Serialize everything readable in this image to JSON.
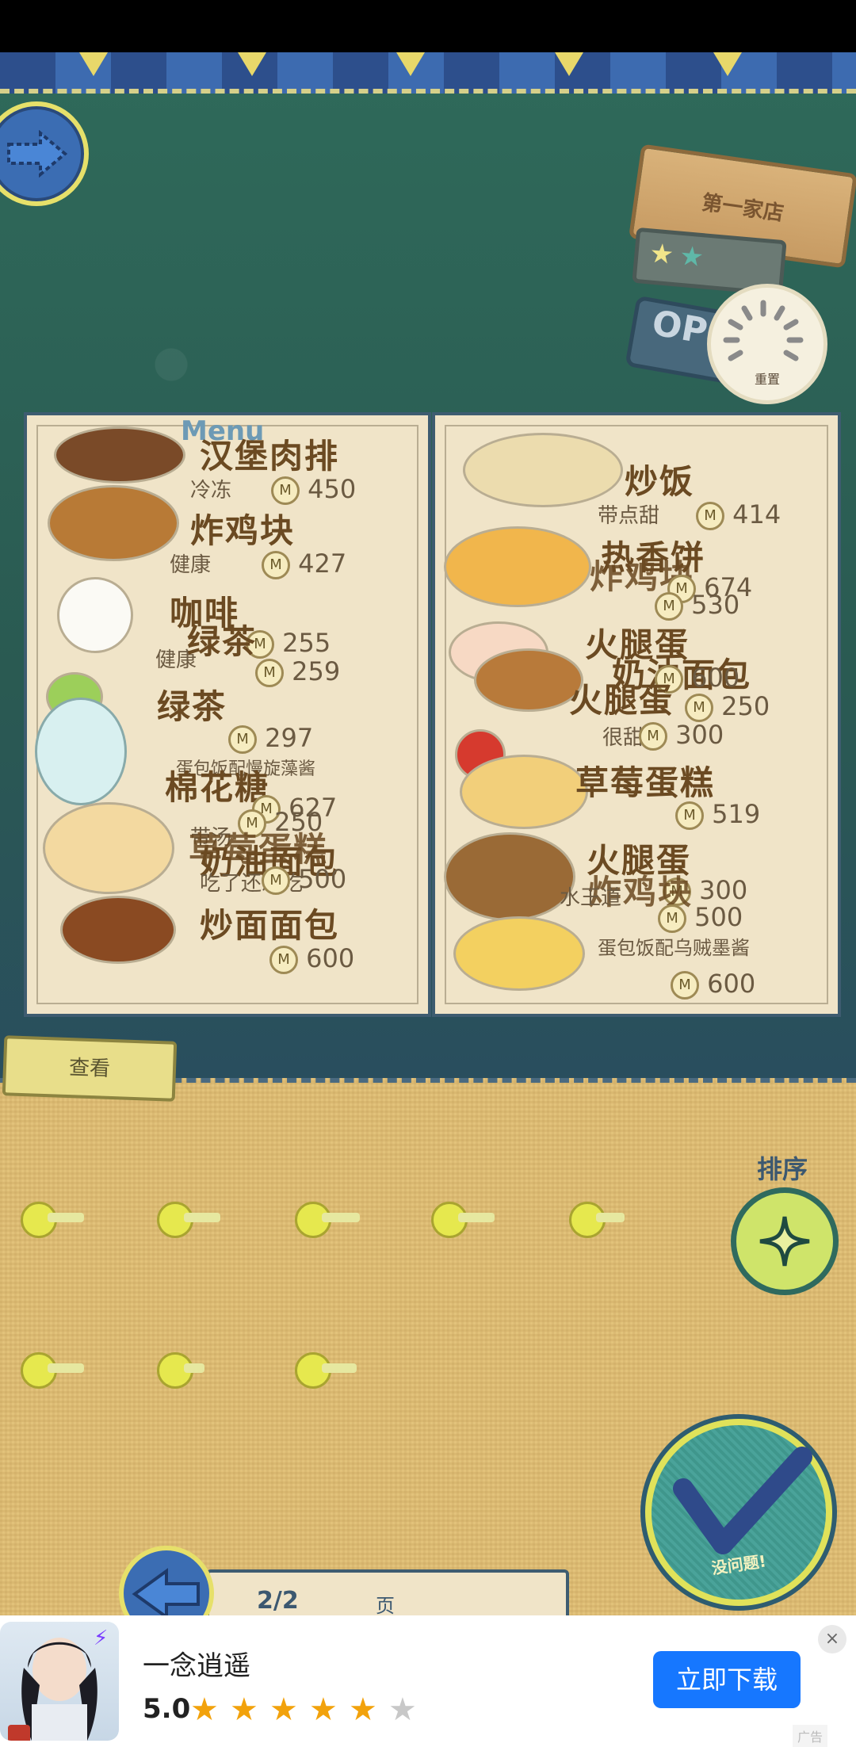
{
  "header": {
    "store_name": "第一家店",
    "open_text": "OPE",
    "reset_label": "重置"
  },
  "menu": {
    "title": "Menu",
    "left": [
      {
        "name": "汉堡肉排",
        "sub": "冷冻",
        "price": "450"
      },
      {
        "name": "炸鸡块",
        "sub": "健康",
        "price": "427"
      },
      {
        "name": "咖啡",
        "sub": "健康",
        "price": "255"
      },
      {
        "name": "绿茶",
        "sub": "健康",
        "price": "259"
      },
      {
        "name": "绿茶",
        "sub": "",
        "price": "297"
      },
      {
        "name": "棉花糖",
        "sub": "蛋包饭配慢旋藻酱",
        "price": "627"
      },
      {
        "name": "奶油面包",
        "sub": "带汤",
        "price": "250"
      },
      {
        "name": "草莓蛋糕",
        "sub": "吃了还想吃",
        "price": "500"
      },
      {
        "name": "炒面面包",
        "sub": "",
        "price": "600"
      }
    ],
    "right": [
      {
        "name": "炒饭",
        "sub": "带点甜",
        "price": "414"
      },
      {
        "name": "热香饼",
        "sub": "",
        "price": "674"
      },
      {
        "name": "炸鸡块",
        "sub": "",
        "price": "530"
      },
      {
        "name": "火腿蛋",
        "sub": "",
        "price": "600"
      },
      {
        "name": "奶油面包",
        "sub": "",
        "price": "250"
      },
      {
        "name": "火腿蛋",
        "sub": "很甜",
        "price": "300"
      },
      {
        "name": "草莓蛋糕",
        "sub": "",
        "price": "519"
      },
      {
        "name": "火腿蛋",
        "sub": "",
        "price": "300"
      },
      {
        "name": "炸鸡块",
        "sub": "水王道",
        "price": "500"
      },
      {
        "name": "",
        "sub": "蛋包饭配乌贼墨酱",
        "price": "600"
      }
    ]
  },
  "panel": {
    "view_tab": "查看",
    "sort_label": "排序",
    "confirm_label": "没问题!",
    "page_indicator": "2/2",
    "page_unit": "页"
  },
  "ad": {
    "title": "一念逍遥",
    "rating": "5.0",
    "stars_filled": 4,
    "stars_total": 5,
    "download_label": "立即下载",
    "close_label": "×",
    "tag": "广告"
  },
  "colors": {
    "accent_blue": "#1677ff",
    "menu_text": "#6b4a22",
    "panel": "#e2c27a"
  }
}
